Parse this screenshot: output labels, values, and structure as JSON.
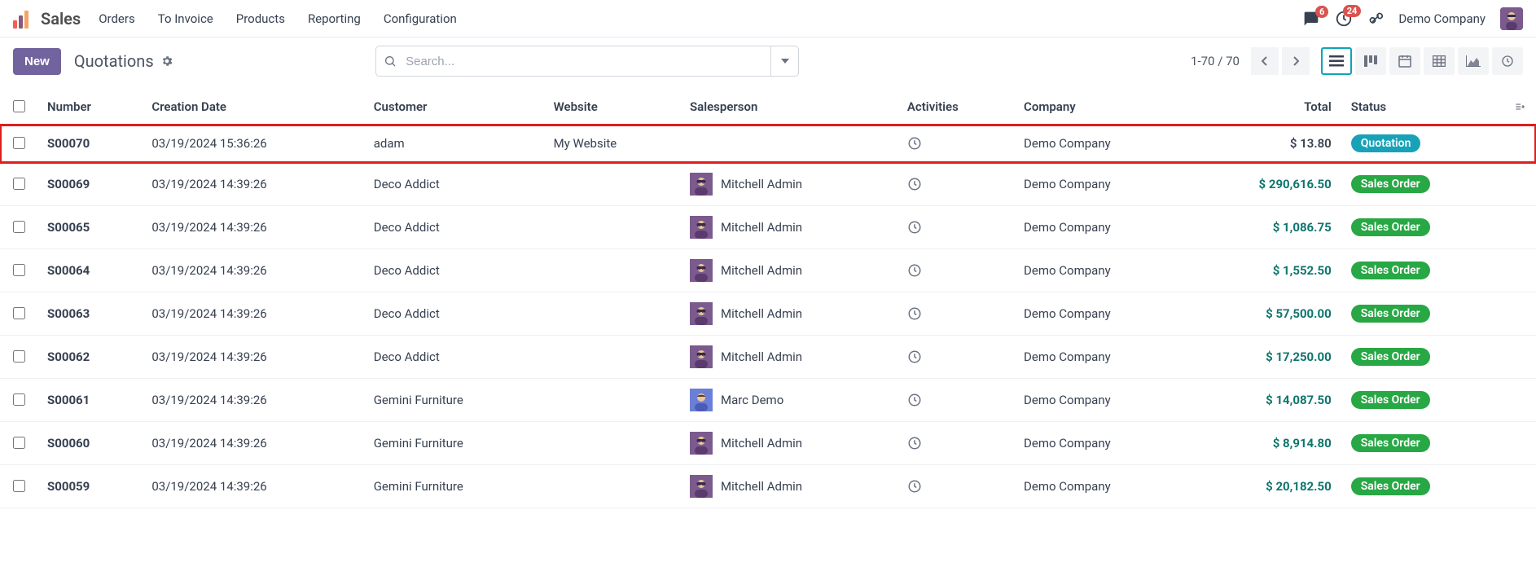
{
  "nav": {
    "app_name": "Sales",
    "links": [
      "Orders",
      "To Invoice",
      "Products",
      "Reporting",
      "Configuration"
    ],
    "messages_badge": "6",
    "activities_badge": "24",
    "company": "Demo Company"
  },
  "control": {
    "new_label": "New",
    "breadcrumb": "Quotations",
    "search_placeholder": "Search...",
    "pager": "1-70 / 70"
  },
  "columns": {
    "number": "Number",
    "creation_date": "Creation Date",
    "customer": "Customer",
    "website": "Website",
    "salesperson": "Salesperson",
    "activities": "Activities",
    "company": "Company",
    "total": "Total",
    "status": "Status"
  },
  "rows": [
    {
      "number": "S00070",
      "date": "03/19/2024 15:36:26",
      "customer": "adam",
      "website": "My Website",
      "salesperson": "",
      "sp_style": "",
      "company": "Demo Company",
      "total": "$ 13.80",
      "total_plain": true,
      "status": "Quotation",
      "status_kind": "quot",
      "highlight": true
    },
    {
      "number": "S00069",
      "date": "03/19/2024 14:39:26",
      "customer": "Deco Addict",
      "website": "",
      "salesperson": "Mitchell Admin",
      "sp_style": "sp1",
      "company": "Demo Company",
      "total": "$ 290,616.50",
      "status": "Sales Order",
      "status_kind": "order"
    },
    {
      "number": "S00065",
      "date": "03/19/2024 14:39:26",
      "customer": "Deco Addict",
      "website": "",
      "salesperson": "Mitchell Admin",
      "sp_style": "sp1",
      "company": "Demo Company",
      "total": "$ 1,086.75",
      "status": "Sales Order",
      "status_kind": "order"
    },
    {
      "number": "S00064",
      "date": "03/19/2024 14:39:26",
      "customer": "Deco Addict",
      "website": "",
      "salesperson": "Mitchell Admin",
      "sp_style": "sp1",
      "company": "Demo Company",
      "total": "$ 1,552.50",
      "status": "Sales Order",
      "status_kind": "order"
    },
    {
      "number": "S00063",
      "date": "03/19/2024 14:39:26",
      "customer": "Deco Addict",
      "website": "",
      "salesperson": "Mitchell Admin",
      "sp_style": "sp1",
      "company": "Demo Company",
      "total": "$ 57,500.00",
      "status": "Sales Order",
      "status_kind": "order"
    },
    {
      "number": "S00062",
      "date": "03/19/2024 14:39:26",
      "customer": "Deco Addict",
      "website": "",
      "salesperson": "Mitchell Admin",
      "sp_style": "sp1",
      "company": "Demo Company",
      "total": "$ 17,250.00",
      "status": "Sales Order",
      "status_kind": "order"
    },
    {
      "number": "S00061",
      "date": "03/19/2024 14:39:26",
      "customer": "Gemini Furniture",
      "website": "",
      "salesperson": "Marc Demo",
      "sp_style": "sp2",
      "company": "Demo Company",
      "total": "$ 14,087.50",
      "status": "Sales Order",
      "status_kind": "order"
    },
    {
      "number": "S00060",
      "date": "03/19/2024 14:39:26",
      "customer": "Gemini Furniture",
      "website": "",
      "salesperson": "Mitchell Admin",
      "sp_style": "sp1",
      "company": "Demo Company",
      "total": "$ 8,914.80",
      "status": "Sales Order",
      "status_kind": "order"
    },
    {
      "number": "S00059",
      "date": "03/19/2024 14:39:26",
      "customer": "Gemini Furniture",
      "website": "",
      "salesperson": "Mitchell Admin",
      "sp_style": "sp1",
      "company": "Demo Company",
      "total": "$ 20,182.50",
      "status": "Sales Order",
      "status_kind": "order"
    }
  ]
}
